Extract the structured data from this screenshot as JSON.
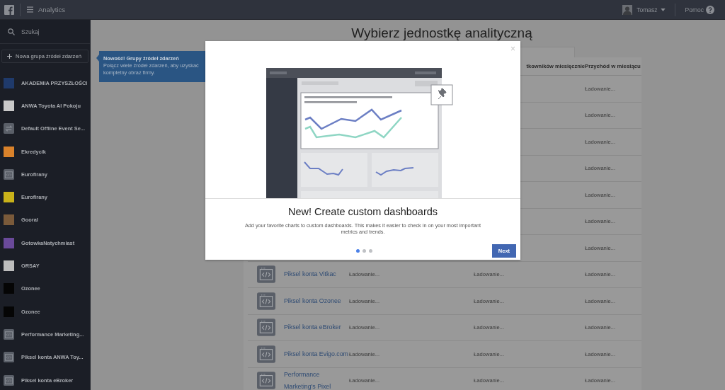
{
  "top_bar": {
    "app_name": "Analytics",
    "user_name": "Tomasz",
    "help": "Pomoc"
  },
  "sidebar": {
    "search": {
      "placeholder": "Szukaj"
    },
    "new_group_button": "Nowa grupa źródeł zdarzeń",
    "items": [
      {
        "name": "AKADEMIA PRZYSZŁOŚCI",
        "kind": "logo",
        "color": "#1f3a6b"
      },
      {
        "name": "ANWA Toyota Al Pokoju",
        "kind": "logo",
        "color": "#c9c9c9"
      },
      {
        "name": "Default Offline Event Se...",
        "kind": "offline"
      },
      {
        "name": "Ekredycik",
        "kind": "logo",
        "color": "#d9822b"
      },
      {
        "name": "Eurofirany",
        "kind": "pixel"
      },
      {
        "name": "Eurofirany",
        "kind": "logo",
        "color": "#c9b21a"
      },
      {
        "name": "Gooral",
        "kind": "logo",
        "color": "#7a5a3a"
      },
      {
        "name": "GotowkaNatychmiast",
        "kind": "logo",
        "color": "#6a4a9a"
      },
      {
        "name": "ORSAY",
        "kind": "logo",
        "color": "#bdbdbd"
      },
      {
        "name": "Ozonee",
        "kind": "logo",
        "color": "#050505"
      },
      {
        "name": "Ozonee",
        "kind": "logo",
        "color": "#050505"
      },
      {
        "name": "Performance Marketing...",
        "kind": "pixel"
      },
      {
        "name": "Piksel konta ANWA Toy...",
        "kind": "pixel"
      },
      {
        "name": "Piksel konta eBroker",
        "kind": "pixel"
      }
    ]
  },
  "tooltip": {
    "title": "Nowość! Grupy źródeł zdarzeń",
    "text": "Połącz wiele źródeł zdarzeń, aby uzyskać kompletny obraz firmy."
  },
  "page_title": "Wybierz jednostkę analityczną",
  "table": {
    "columns": {
      "column_3": "tkowników miesięcznie",
      "column_4": "Przychód w miesiącu"
    },
    "hidden_rows": [
      {
        "column_4": "Ładowanie..."
      },
      {
        "column_4": "Ładowanie..."
      },
      {
        "column_4": "Ładowanie..."
      },
      {
        "column_4": "Ładowanie..."
      },
      {
        "column_4": "Ładowanie..."
      },
      {
        "column_4": "Ładowanie..."
      },
      {
        "column_4": "Ładowanie..."
      }
    ],
    "rows": [
      {
        "name": "Piksel konta Vitkac",
        "column_2": "Ładowanie...",
        "column_3": "Ładowanie...",
        "column_4": "Ładowanie..."
      },
      {
        "name": "Piksel konta Ozonee",
        "column_2": "Ładowanie...",
        "column_3": "Ładowanie...",
        "column_4": "Ładowanie..."
      },
      {
        "name": "Piksel konta eBroker",
        "column_2": "Ładowanie...",
        "column_3": "Ładowanie...",
        "column_4": "Ładowanie..."
      },
      {
        "name": "Piksel konta Evigo.com",
        "column_2": "Ładowanie...",
        "column_3": "Ładowanie...",
        "column_4": "Ładowanie..."
      },
      {
        "name": "Performance Marketing's Pixel",
        "column_2": "Ładowanie...",
        "column_3": "Ładowanie...",
        "column_4": "Ładowanie..."
      }
    ]
  },
  "modal": {
    "close": "×",
    "title": "New! Create custom dashboards",
    "text": "Add your favorite charts to custom dashboards. This makes it easier to check in on your most important metrics and trends.",
    "pages": [
      {
        "selected": true
      },
      {
        "selected": false
      },
      {
        "selected": false
      }
    ],
    "next_button": "Next"
  }
}
